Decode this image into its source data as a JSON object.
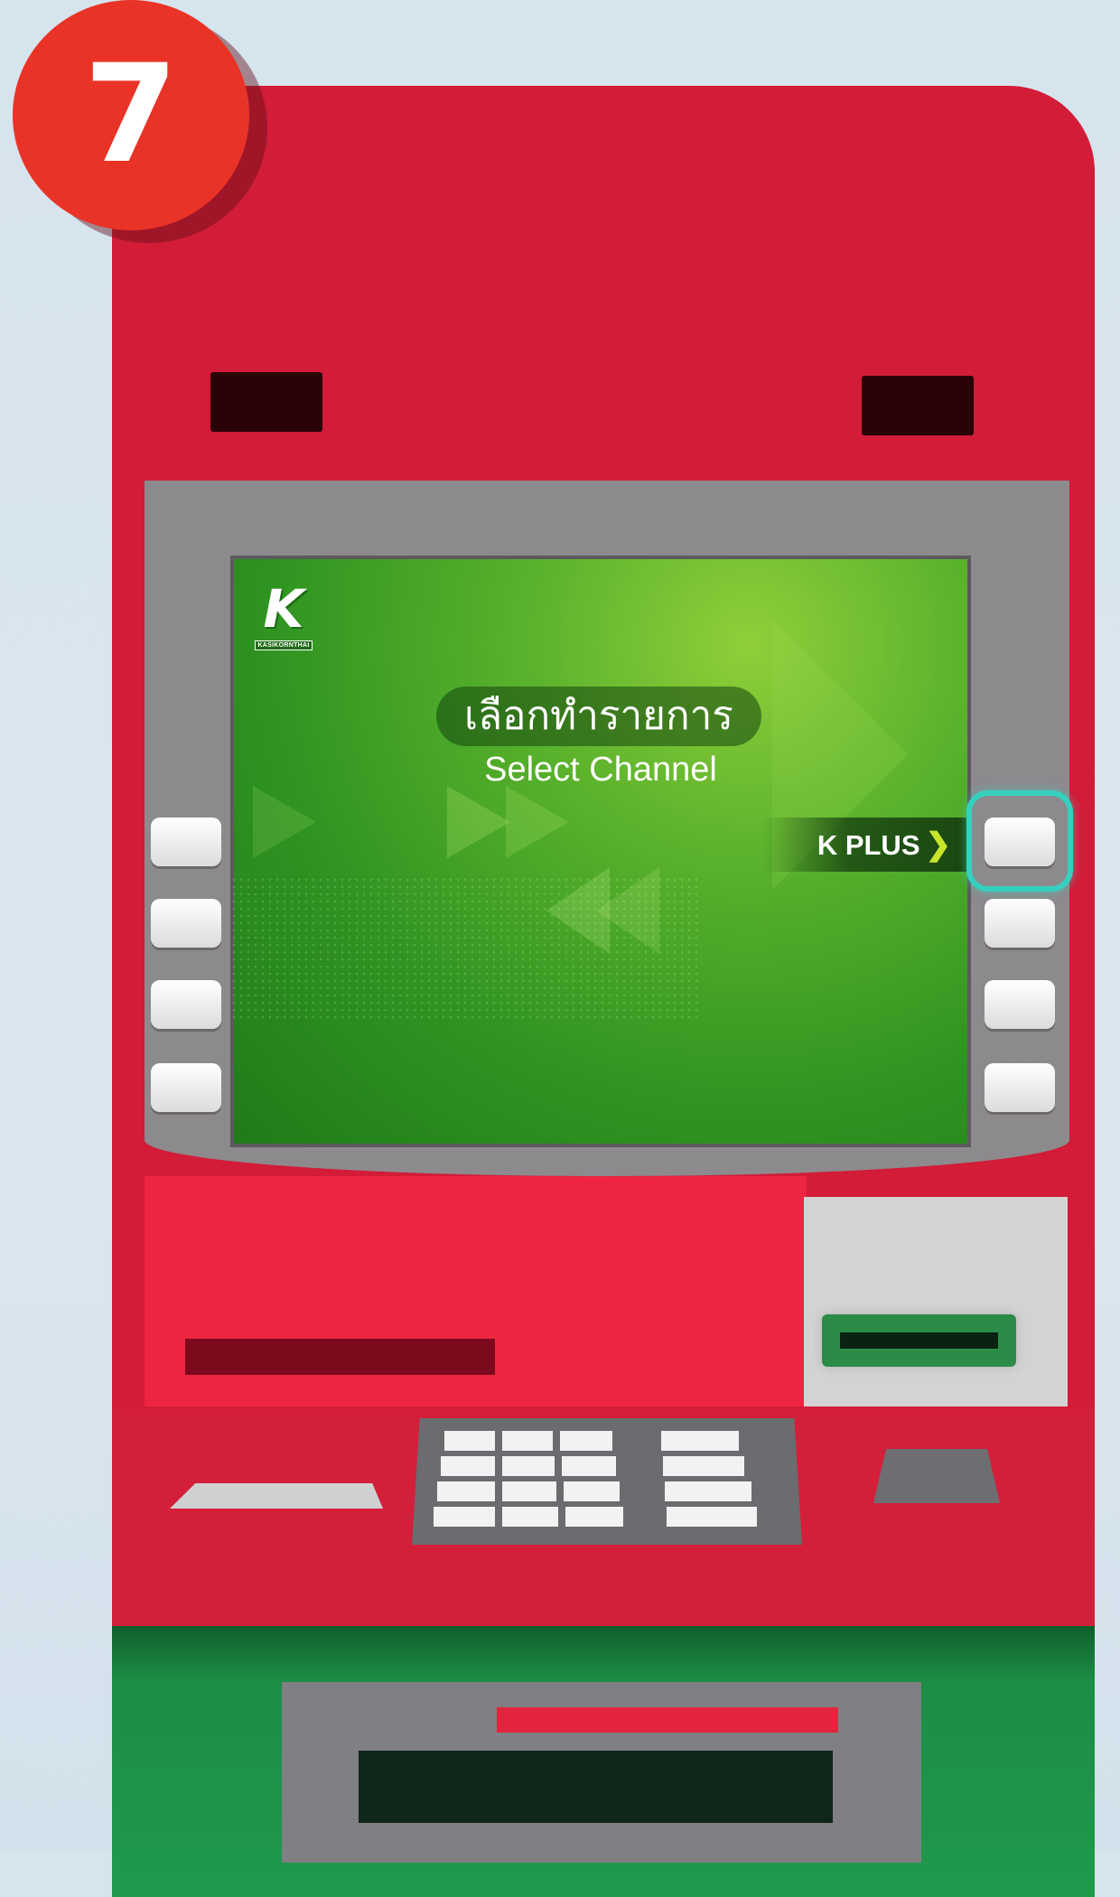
{
  "step": {
    "number": "7"
  },
  "bank_logo": {
    "letter": "K",
    "name": "KASIKORNTHAI"
  },
  "screen": {
    "title_thai": "เลือกทำรายการ",
    "subtitle": "Select Channel",
    "option_right_1": {
      "label": "K PLUS",
      "arrow": "❯"
    }
  },
  "colors": {
    "atm_body": "#d21c38",
    "screen_green": "#2f9421",
    "highlight_ring": "#36d0c0",
    "step_badge": "#ea3327"
  },
  "highlighted_key": "right-function-key-1"
}
